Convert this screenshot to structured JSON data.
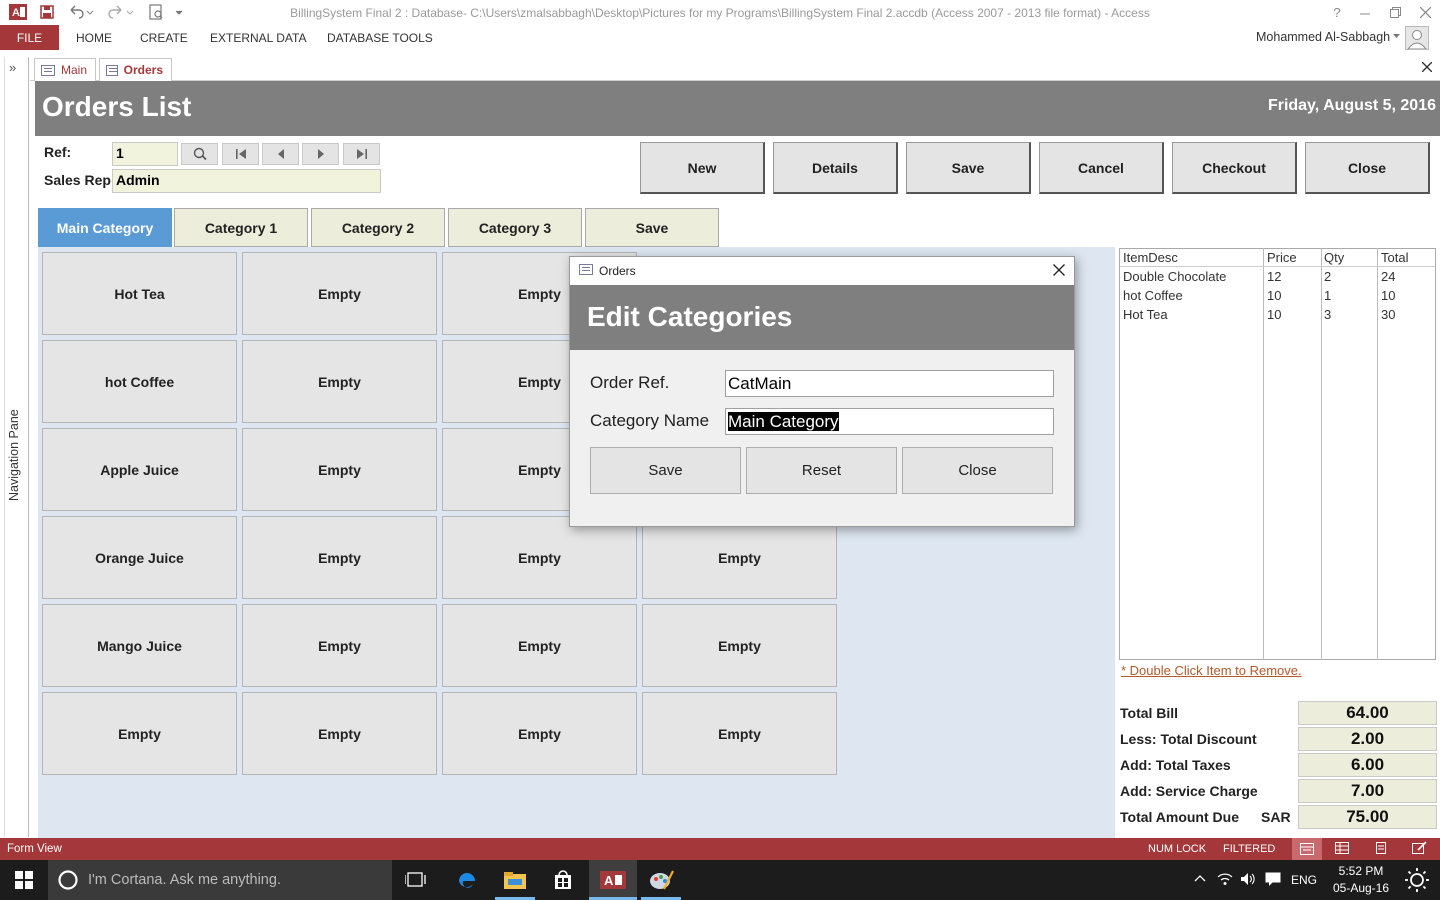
{
  "window": {
    "title": "BillingSystem Final 2 : Database- C:\\Users\\zmalsabbagh\\Desktop\\Pictures for my Programs\\BillingSystem Final 2.accdb (Access 2007 - 2013 file format) - Access",
    "help": "?"
  },
  "ribbon": {
    "file": "FILE",
    "tabs": [
      "HOME",
      "CREATE",
      "EXTERNAL DATA",
      "DATABASE TOOLS"
    ],
    "user": "Mohammed Al-Sabbagh"
  },
  "nav_pane": {
    "label": "Navigation Pane",
    "toggle": "»"
  },
  "doc_tabs": [
    {
      "label": "Main"
    },
    {
      "label": "Orders"
    }
  ],
  "form": {
    "title": "Orders List",
    "date": "Friday, August 5, 2016",
    "ref_label": "Ref:",
    "ref_value": "1",
    "sales_rep_label": "Sales Rep",
    "sales_rep_value": "Admin",
    "buttons": [
      "New",
      "Details",
      "Save",
      "Cancel",
      "Checkout",
      "Close"
    ]
  },
  "category_tabs": [
    "Main Category",
    "Category 1",
    "Category 2",
    "Category 3",
    "Save"
  ],
  "grid": [
    [
      "Hot Tea",
      "Empty",
      "Empty",
      ""
    ],
    [
      "hot Coffee",
      "Empty",
      "Empty",
      ""
    ],
    [
      "Apple Juice",
      "Empty",
      "Empty",
      ""
    ],
    [
      "Orange Juice",
      "Empty",
      "Empty",
      "Empty"
    ],
    [
      "Mango Juice",
      "Empty",
      "Empty",
      "Empty"
    ],
    [
      "Empty",
      "Empty",
      "Empty",
      "Empty"
    ]
  ],
  "items": {
    "headers": [
      "ItemDesc",
      "Price",
      "Qty",
      "Total"
    ],
    "rows": [
      [
        "Double Chocolate",
        "12",
        "2",
        "24"
      ],
      [
        "hot Coffee",
        "10",
        "1",
        "10"
      ],
      [
        "Hot Tea",
        "10",
        "3",
        "30"
      ]
    ],
    "remove_hint": "* Double Click Item to Remove."
  },
  "totals": {
    "total_bill_label": "Total Bill",
    "total_bill": "64.00",
    "discount_label": "Less: Total Discount",
    "discount": "2.00",
    "taxes_label": "Add: Total Taxes",
    "taxes": "6.00",
    "service_label": "Add: Service Charge",
    "service": "7.00",
    "amount_due_label": "Total Amount Due",
    "currency": "SAR",
    "amount_due": "75.00"
  },
  "dialog": {
    "window_title": "Orders",
    "heading": "Edit Categories",
    "order_ref_label": "Order Ref.",
    "order_ref_value": "CatMain",
    "category_name_label": "Category Name",
    "category_name_value": "Main Category",
    "buttons": [
      "Save",
      "Reset",
      "Close"
    ]
  },
  "statusbar": {
    "view": "Form View",
    "num_lock": "NUM LOCK",
    "filtered": "FILTERED"
  },
  "taskbar": {
    "cortana": "I'm Cortana. Ask me anything.",
    "lang": "ENG",
    "time": "5:52 PM",
    "date": "05-Aug-16"
  },
  "colors": {
    "access_accent": "#a4373a",
    "header_gray": "#7f7f7f",
    "active_tab": "#5b9bd5",
    "grid_bg": "#dde6f1"
  }
}
